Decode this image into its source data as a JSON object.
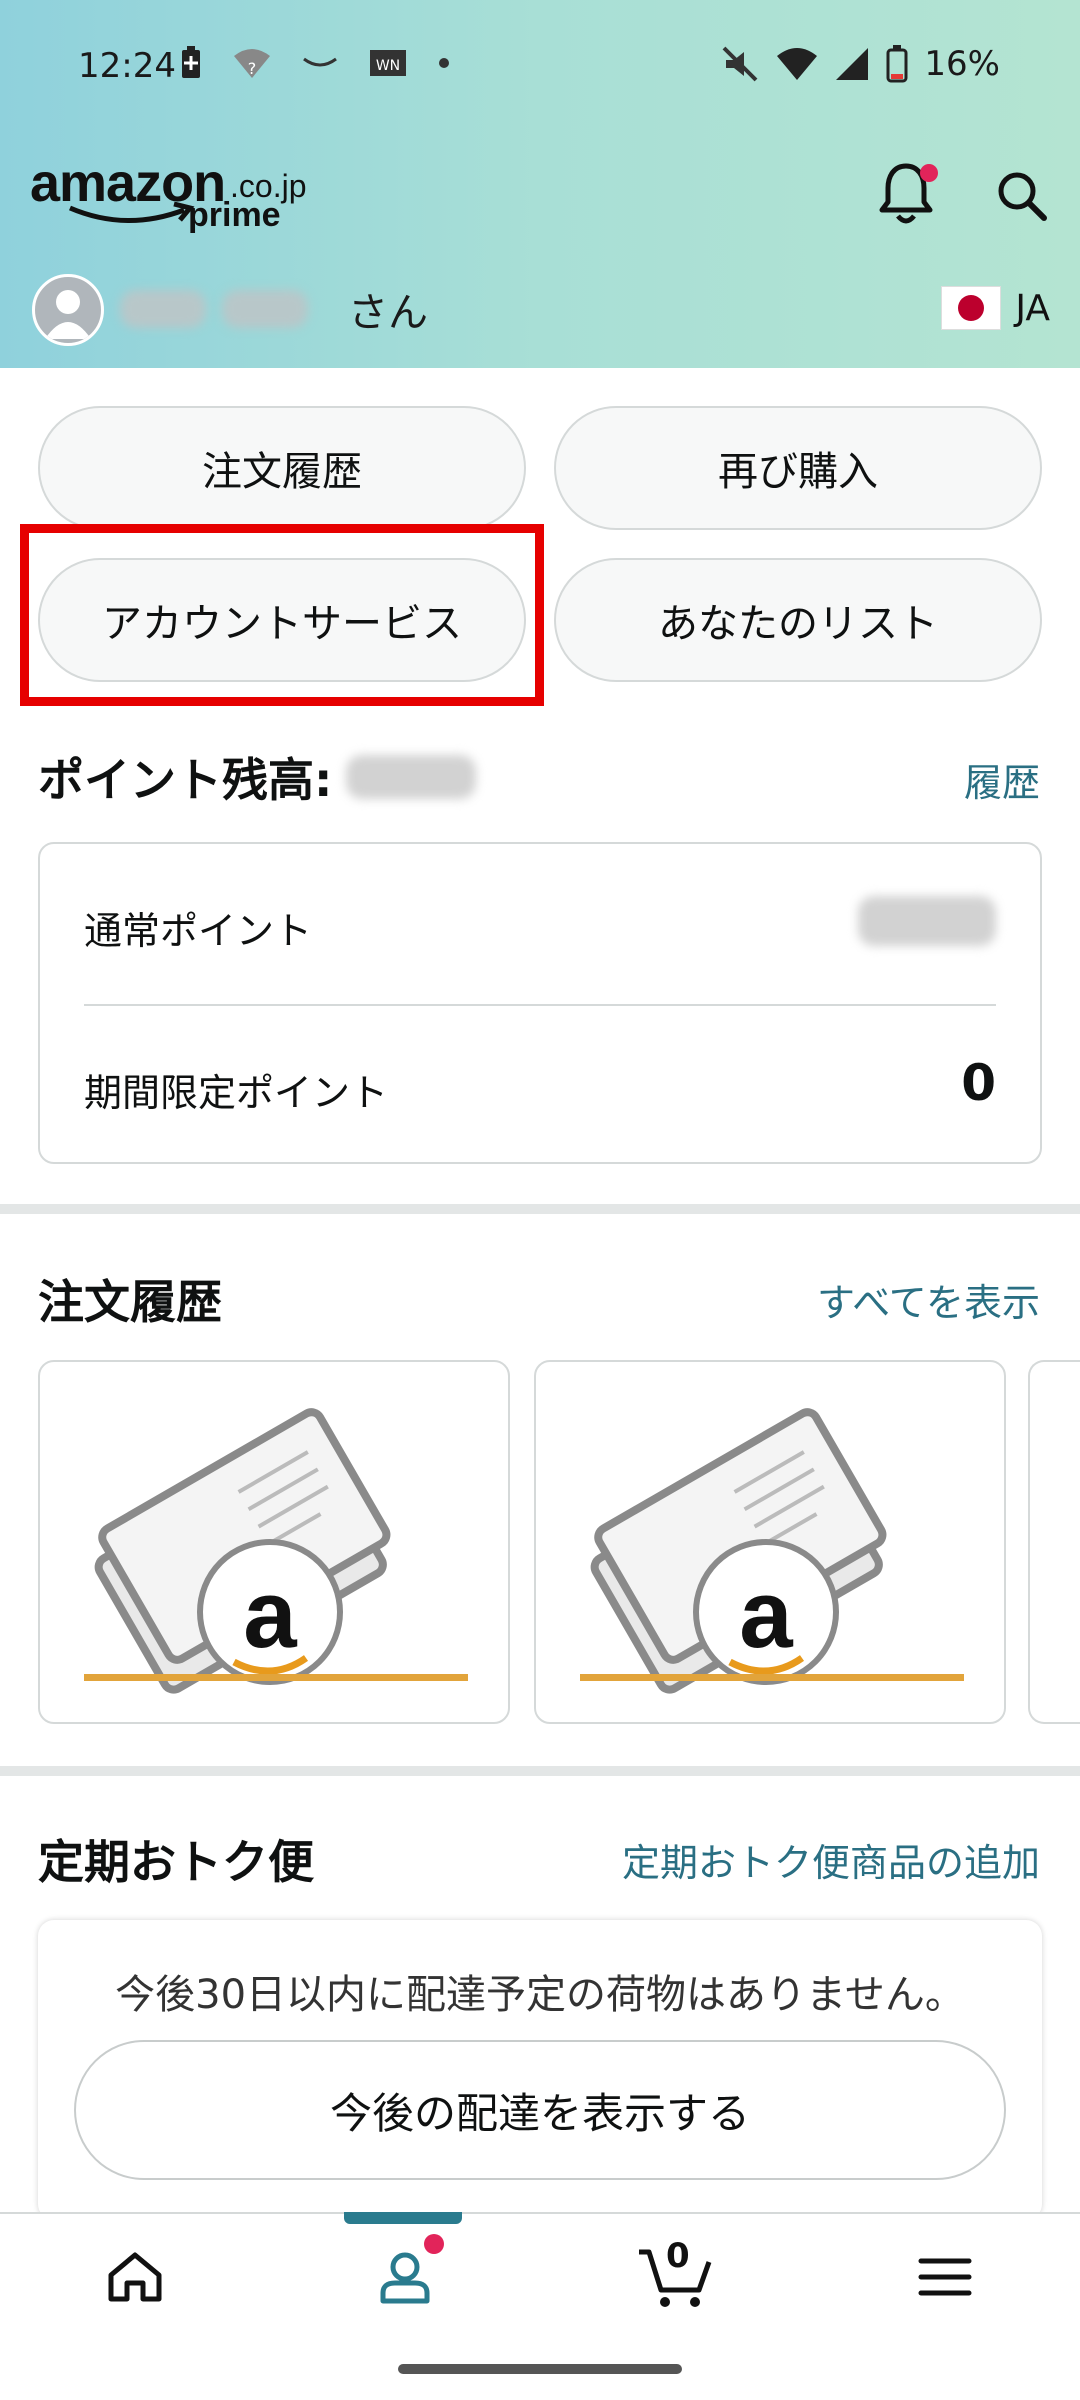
{
  "status_bar": {
    "time": "12:24",
    "battery": "16%"
  },
  "header": {
    "logo": {
      "main": "amazon",
      "domain": ".co.jp",
      "sub": "prime"
    },
    "greeting_suffix": "さん",
    "language": "JA"
  },
  "quick_buttons": {
    "orders": "注文履歴",
    "buy_again": "再び購入",
    "account_services": "アカウントサービス",
    "your_lists": "あなたのリスト"
  },
  "points": {
    "title": "ポイント残高:",
    "history_link": "履歴",
    "regular_label": "通常ポイント",
    "limited_label": "期間限定ポイント",
    "limited_value": "0"
  },
  "orders": {
    "title": "注文履歴",
    "view_all": "すべてを表示",
    "items": [
      {
        "image": "amazon-gift-card-illustration"
      },
      {
        "image": "amazon-gift-card-illustration"
      }
    ]
  },
  "subscribe": {
    "title": "定期おトク便",
    "add_link": "定期おトク便商品の追加",
    "empty_message": "今後30日以内に配達予定の荷物はありません。",
    "button": "今後の配達を表示する"
  },
  "bottom_nav": {
    "cart_count": "0",
    "active_tab": "account",
    "items": [
      "home-icon",
      "account-icon",
      "cart-icon",
      "menu-icon"
    ]
  },
  "colors": {
    "accent": "#2a6f83",
    "highlight": "#e60000",
    "badge": "#e2245a"
  }
}
